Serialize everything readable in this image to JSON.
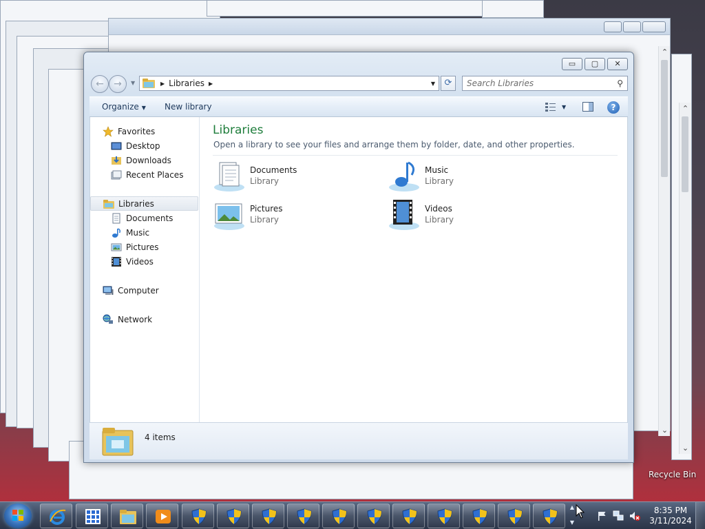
{
  "window": {
    "breadcrumb": "Libraries",
    "search_placeholder": "Search Libraries",
    "controls": {
      "minimize": "▭",
      "maximize": "▢",
      "close": "✕"
    }
  },
  "toolbar": {
    "organize_label": "Organize",
    "new_library_label": "New library"
  },
  "sidebar": {
    "favorites": {
      "label": "Favorites",
      "items": [
        {
          "label": "Desktop",
          "icon": "desktop-icon"
        },
        {
          "label": "Downloads",
          "icon": "downloads-icon"
        },
        {
          "label": "Recent Places",
          "icon": "recent-places-icon"
        }
      ]
    },
    "libraries": {
      "label": "Libraries",
      "items": [
        {
          "label": "Documents",
          "icon": "documents-icon"
        },
        {
          "label": "Music",
          "icon": "music-icon"
        },
        {
          "label": "Pictures",
          "icon": "pictures-icon"
        },
        {
          "label": "Videos",
          "icon": "videos-icon"
        }
      ]
    },
    "computer": {
      "label": "Computer"
    },
    "network": {
      "label": "Network"
    }
  },
  "content": {
    "title": "Libraries",
    "subtitle": "Open a library to see your files and arrange them by folder, date, and other properties.",
    "libraries": [
      {
        "name": "Documents",
        "type": "Library"
      },
      {
        "name": "Music",
        "type": "Library"
      },
      {
        "name": "Pictures",
        "type": "Library"
      },
      {
        "name": "Videos",
        "type": "Library"
      }
    ]
  },
  "details": {
    "count": "4 items"
  },
  "desktop": {
    "recycle_bin_label": "Recycle Bin"
  },
  "taskbar": {
    "time": "8:35 PM",
    "date": "3/11/2024"
  },
  "colors": {
    "title_green": "#1e7d3b",
    "taskbar": "#3d4a60",
    "accent_blue": "#1e5eb4"
  }
}
